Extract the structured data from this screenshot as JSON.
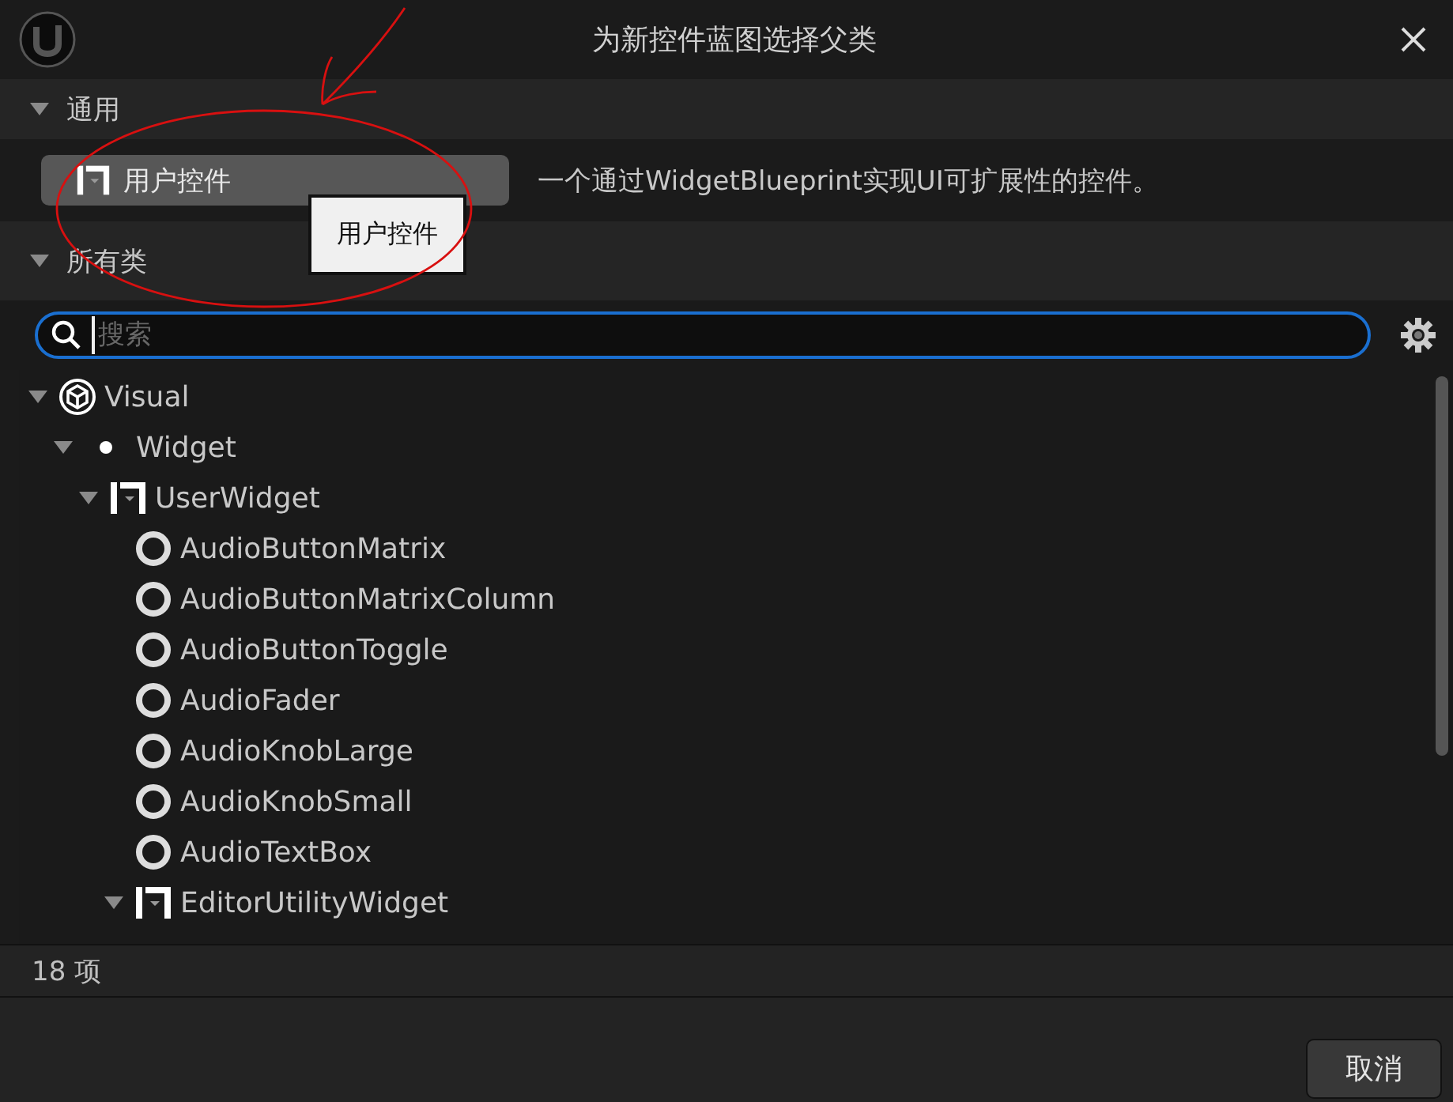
{
  "window": {
    "title": "为新控件蓝图选择父类"
  },
  "common_section": {
    "title": "通用",
    "expanded": true,
    "button": {
      "label": "用户控件"
    },
    "description": "一个通过WidgetBlueprint实现UI可扩展性的控件。",
    "tooltip": "用户控件"
  },
  "all_classes_section": {
    "title": "所有类",
    "expanded": true
  },
  "search": {
    "placeholder": "搜索"
  },
  "tree": [
    {
      "label": "Visual",
      "kind": "cube",
      "expanded": true,
      "children": [
        {
          "label": "Widget",
          "kind": "dot",
          "expanded": true,
          "children": [
            {
              "label": "UserWidget",
              "kind": "widget",
              "expanded": true,
              "children": [
                {
                  "label": "AudioButtonMatrix",
                  "kind": "ring"
                },
                {
                  "label": "AudioButtonMatrixColumn",
                  "kind": "ring"
                },
                {
                  "label": "AudioButtonToggle",
                  "kind": "ring"
                },
                {
                  "label": "AudioFader",
                  "kind": "ring"
                },
                {
                  "label": "AudioKnobLarge",
                  "kind": "ring"
                },
                {
                  "label": "AudioKnobSmall",
                  "kind": "ring"
                },
                {
                  "label": "AudioTextBox",
                  "kind": "ring"
                },
                {
                  "label": "EditorUtilityWidget",
                  "kind": "widget",
                  "expanded": true
                }
              ]
            }
          ]
        }
      ]
    }
  ],
  "status_bar": {
    "count": "18 项"
  },
  "buttons": [
    {
      "label": "取消"
    }
  ]
}
